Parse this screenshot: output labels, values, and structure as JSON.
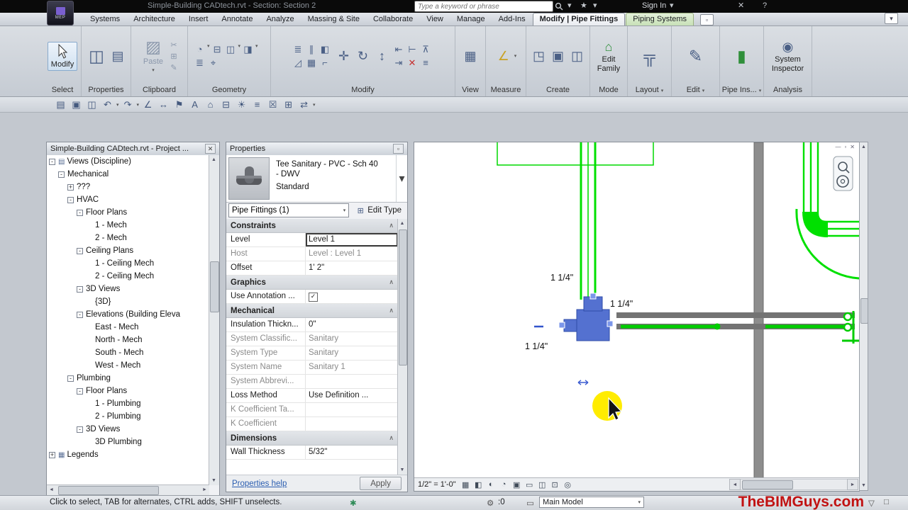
{
  "title_bar": {
    "app_badge": "MEP",
    "title": "Simple-Building CADtech.rvt - Section: Section 2",
    "search_placeholder": "Type a keyword or phrase",
    "sign_in": "Sign In"
  },
  "ribbon": {
    "tabs": [
      {
        "label": "Systems"
      },
      {
        "label": "Architecture"
      },
      {
        "label": "Insert"
      },
      {
        "label": "Annotate"
      },
      {
        "label": "Analyze"
      },
      {
        "label": "Massing & Site"
      },
      {
        "label": "Collaborate"
      },
      {
        "label": "View"
      },
      {
        "label": "Manage"
      },
      {
        "label": "Add-Ins"
      },
      {
        "label": "Modify | Pipe Fittings",
        "state": "active"
      },
      {
        "label": "Piping Systems",
        "state": "contextual"
      }
    ],
    "panel_labels": [
      "Select",
      "Properties",
      "Clipboard",
      "Geometry",
      "Modify",
      "View",
      "Measure",
      "Create",
      "Mode",
      "Layout",
      "Edit",
      "Pipe Ins...",
      "Analysis"
    ],
    "modify_label": "Modify",
    "paste_label": "Paste",
    "edit_family_l1": "Edit",
    "edit_family_l2": "Family",
    "system_inspector_l1": "System",
    "system_inspector_l2": "Inspector"
  },
  "project_browser": {
    "title": "Simple-Building CADtech.rvt - Project ...",
    "tree": [
      {
        "label": "Views (Discipline)",
        "indent": 0,
        "toggle": "-",
        "icon": "tree-views"
      },
      {
        "label": "Mechanical",
        "indent": 1,
        "toggle": "-"
      },
      {
        "label": "???",
        "indent": 2,
        "toggle": "+"
      },
      {
        "label": "HVAC",
        "indent": 2,
        "toggle": "-"
      },
      {
        "label": "Floor Plans",
        "indent": 3,
        "toggle": "-"
      },
      {
        "label": "1 - Mech",
        "indent": 4
      },
      {
        "label": "2 - Mech",
        "indent": 4
      },
      {
        "label": "Ceiling Plans",
        "indent": 3,
        "toggle": "-"
      },
      {
        "label": "1 - Ceiling Mech",
        "indent": 4
      },
      {
        "label": "2 - Ceiling Mech",
        "indent": 4
      },
      {
        "label": "3D Views",
        "indent": 3,
        "toggle": "-"
      },
      {
        "label": "{3D}",
        "indent": 4
      },
      {
        "label": "Elevations (Building Eleva",
        "indent": 3,
        "toggle": "-"
      },
      {
        "label": "East - Mech",
        "indent": 4
      },
      {
        "label": "North - Mech",
        "indent": 4
      },
      {
        "label": "South - Mech",
        "indent": 4
      },
      {
        "label": "West - Mech",
        "indent": 4
      },
      {
        "label": "Plumbing",
        "indent": 2,
        "toggle": "-"
      },
      {
        "label": "Floor Plans",
        "indent": 3,
        "toggle": "-"
      },
      {
        "label": "1 - Plumbing",
        "indent": 4
      },
      {
        "label": "2 - Plumbing",
        "indent": 4
      },
      {
        "label": "3D Views",
        "indent": 3,
        "toggle": "-"
      },
      {
        "label": "3D Plumbing",
        "indent": 4
      },
      {
        "label": "Legends",
        "indent": 0,
        "toggle": "+",
        "icon": "tree-legends"
      }
    ]
  },
  "properties": {
    "title": "Properties",
    "type_line1": "Tee Sanitary - PVC - Sch 40",
    "type_line2": "- DWV",
    "type_line3": "Standard",
    "selector": "Pipe Fittings (1)",
    "edit_type": "Edit Type",
    "sections": [
      {
        "header": "Constraints",
        "rows": [
          {
            "label": "Level",
            "value": "Level 1",
            "focused": true
          },
          {
            "label": "Host",
            "value": "Level : Level 1",
            "readonly": true
          },
          {
            "label": "Offset",
            "value": "1'  2\""
          }
        ]
      },
      {
        "header": "Graphics",
        "rows": [
          {
            "label": "Use Annotation ...",
            "checkbox": true
          }
        ]
      },
      {
        "header": "Mechanical",
        "rows": [
          {
            "label": "Insulation Thickn...",
            "value": "0\""
          },
          {
            "label": "System Classific...",
            "value": "Sanitary",
            "readonly": true
          },
          {
            "label": "System Type",
            "value": "Sanitary",
            "readonly": true
          },
          {
            "label": "System Name",
            "value": "Sanitary 1",
            "readonly": true
          },
          {
            "label": "System Abbrevi...",
            "value": "",
            "readonly": true
          },
          {
            "label": "Loss Method",
            "value": "Use Definition ..."
          },
          {
            "label": "K Coefficient Ta...",
            "value": "",
            "readonly": true
          },
          {
            "label": "K Coefficient",
            "value": "",
            "readonly": true
          }
        ]
      },
      {
        "header": "Dimensions",
        "rows": [
          {
            "label": "Wall Thickness",
            "value": "5/32\""
          }
        ]
      }
    ],
    "help_link": "Properties help",
    "apply": "Apply"
  },
  "canvas": {
    "dims": [
      "1 1/4\"",
      "1 1/4\"",
      "1 1/4\""
    ],
    "scale": "1/2\" = 1'-0\"",
    "watermark": "TheBIMGuys.com"
  },
  "status_bar": {
    "message": "Click to select, TAB for alternates, CTRL adds, SHIFT unselects.",
    "workset_count": ":0",
    "design_option": "Main Model"
  },
  "icons": {
    "dropdown": "▾",
    "collapse": "∧",
    "check": "✓",
    "close": "✕",
    "win-min": "—",
    "win-restore": "▫",
    "win-close": "✕",
    "star": "★",
    "help": "?",
    "open": "▤",
    "save": "▣",
    "print": "◫",
    "undo": "↶",
    "redo": "↷",
    "measure": "∠",
    "dimension": "↔",
    "tag": "⚑",
    "text": "A",
    "home-3d": "⌂",
    "section": "⊟",
    "sun": "☀",
    "thin-lines": "≡",
    "close-hidden": "☒",
    "windows": "⊞",
    "switch": "⇄",
    "properties-big": "◫",
    "properties-small": "▤",
    "paste": "▨",
    "cut": "✂",
    "copy": "⊞",
    "match": "✎",
    "geo-1": "◔",
    "geo-2": "⊟",
    "geo-3": "◫",
    "geo-4": "◨",
    "geo-5": "≣",
    "geo-6": "⌖",
    "align": "≣",
    "offset": "∥",
    "mirror": "◧",
    "scale": "◿",
    "array": "▦",
    "trim": "⌐",
    "move": "✛",
    "rotate": "↻",
    "pin": "⊼",
    "delete": "✕",
    "ext-left": "⇤",
    "ext-right": "⇥",
    "split": "⊢",
    "vert": "↕",
    "view-grid": "▦",
    "create-1": "◳",
    "create-2": "▣",
    "create-3": "◫",
    "family": "⌂",
    "layout": "╦",
    "edit-pipe": "✎",
    "pipe-ins": "▮",
    "inspector": "◉",
    "edit-type": "⊞",
    "vb-1": "▦",
    "vb-2": "◧",
    "vb-3": "◐",
    "vb-4": "◔",
    "vb-5": "▣",
    "vb-6": "▭",
    "vb-7": "◫",
    "vb-8": "⊡",
    "vb-9": "◎",
    "tree-views": "▤",
    "tree-legends": "▦",
    "flower": "✱",
    "gear": "⚙",
    "design-opt": "▭",
    "funnel": "▽",
    "box": "□",
    "arrow-up": "▲",
    "arrow-down": "▼",
    "arrow-left": "◄",
    "arrow-right": "►",
    "expand-plus": "+",
    "expand-minus": "-"
  }
}
